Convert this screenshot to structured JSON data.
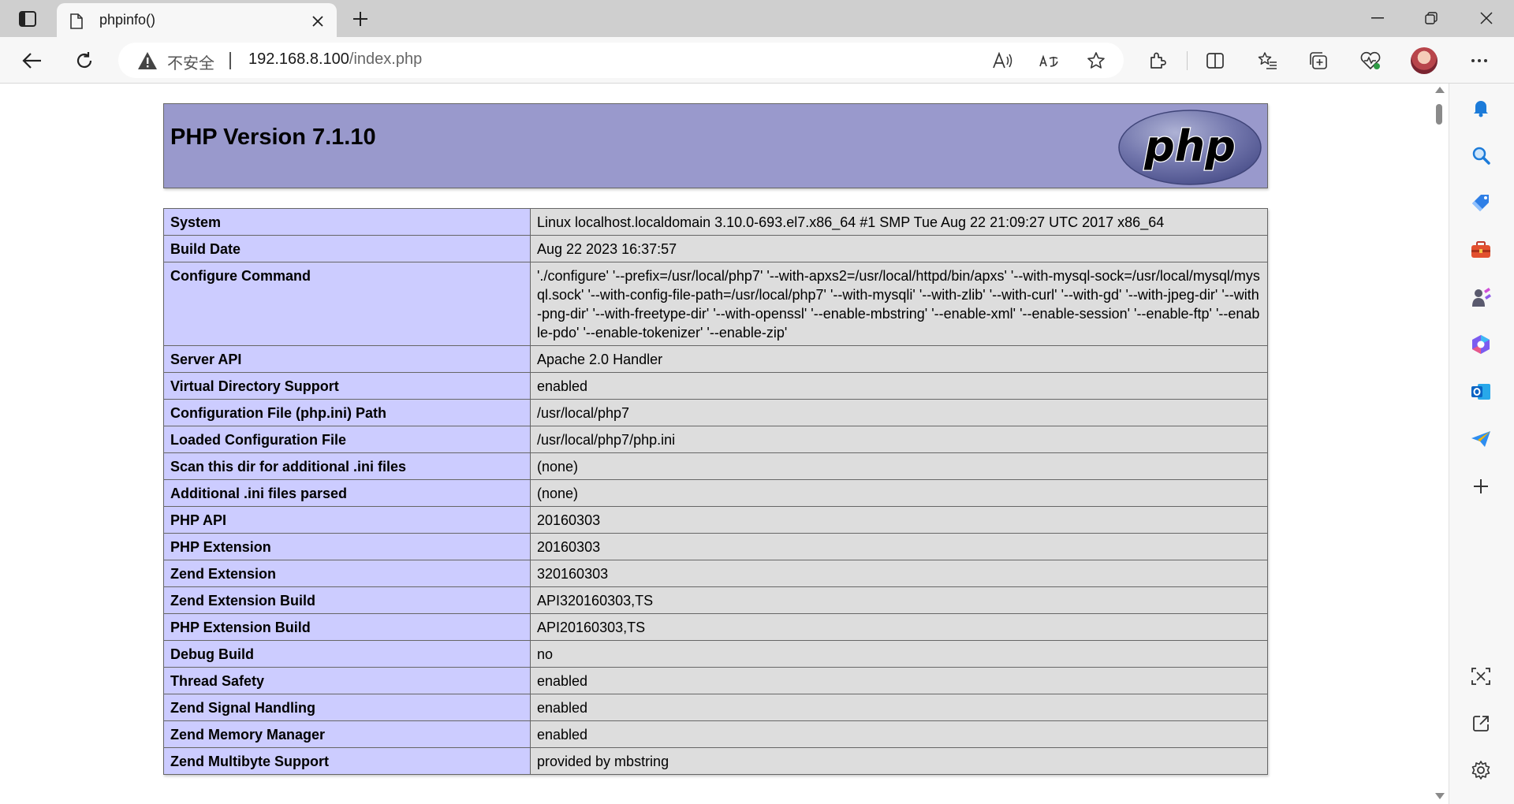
{
  "browser": {
    "tab": {
      "title": "phpinfo()"
    },
    "address_bar": {
      "security_label": "不安全",
      "url_host": "192.168.8.100",
      "url_path": "/index.php"
    }
  },
  "page": {
    "version_title": "PHP Version 7.1.10",
    "logo_text": "php",
    "rows": [
      {
        "key": "System",
        "value": "Linux localhost.localdomain 3.10.0-693.el7.x86_64 #1 SMP Tue Aug 22 21:09:27 UTC 2017 x86_64"
      },
      {
        "key": "Build Date",
        "value": "Aug 22 2023 16:37:57"
      },
      {
        "key": "Configure Command",
        "value": "'./configure' '--prefix=/usr/local/php7' '--with-apxs2=/usr/local/httpd/bin/apxs' '--with-mysql-sock=/usr/local/mysql/mysql.sock' '--with-config-file-path=/usr/local/php7' '--with-mysqli' '--with-zlib' '--with-curl' '--with-gd' '--with-jpeg-dir' '--with-png-dir' '--with-freetype-dir' '--with-openssl' '--enable-mbstring' '--enable-xml' '--enable-session' '--enable-ftp' '--enable-pdo' '--enable-tokenizer' '--enable-zip'"
      },
      {
        "key": "Server API",
        "value": "Apache 2.0 Handler"
      },
      {
        "key": "Virtual Directory Support",
        "value": "enabled"
      },
      {
        "key": "Configuration File (php.ini) Path",
        "value": "/usr/local/php7"
      },
      {
        "key": "Loaded Configuration File",
        "value": "/usr/local/php7/php.ini"
      },
      {
        "key": "Scan this dir for additional .ini files",
        "value": "(none)"
      },
      {
        "key": "Additional .ini files parsed",
        "value": "(none)"
      },
      {
        "key": "PHP API",
        "value": "20160303"
      },
      {
        "key": "PHP Extension",
        "value": "20160303"
      },
      {
        "key": "Zend Extension",
        "value": "320160303"
      },
      {
        "key": "Zend Extension Build",
        "value": "API320160303,TS"
      },
      {
        "key": "PHP Extension Build",
        "value": "API20160303,TS"
      },
      {
        "key": "Debug Build",
        "value": "no"
      },
      {
        "key": "Thread Safety",
        "value": "enabled"
      },
      {
        "key": "Zend Signal Handling",
        "value": "enabled"
      },
      {
        "key": "Zend Memory Manager",
        "value": "enabled"
      },
      {
        "key": "Zend Multibyte Support",
        "value": "provided by mbstring"
      }
    ]
  },
  "icons": {
    "toolbar": [
      "back-icon",
      "refresh-icon",
      "warning-icon",
      "read-aloud-icon",
      "translate-icon",
      "favorite-star-icon",
      "extensions-icon",
      "split-screen-icon",
      "favorites-list-icon",
      "collections-icon",
      "browser-essentials-icon",
      "profile-avatar",
      "more-icon"
    ],
    "sidebar": [
      "bell-icon",
      "search-icon",
      "shopping-tag-icon",
      "toolbox-icon",
      "games-icon",
      "copilot-icon",
      "outlook-icon",
      "send-icon",
      "add-icon",
      "screenshot-icon",
      "open-external-icon",
      "settings-gear-icon"
    ]
  },
  "colors": {
    "php_header_bg": "#9999cc",
    "key_cell_bg": "#ccccff",
    "value_cell_bg": "#dddddd",
    "border": "#666666"
  }
}
